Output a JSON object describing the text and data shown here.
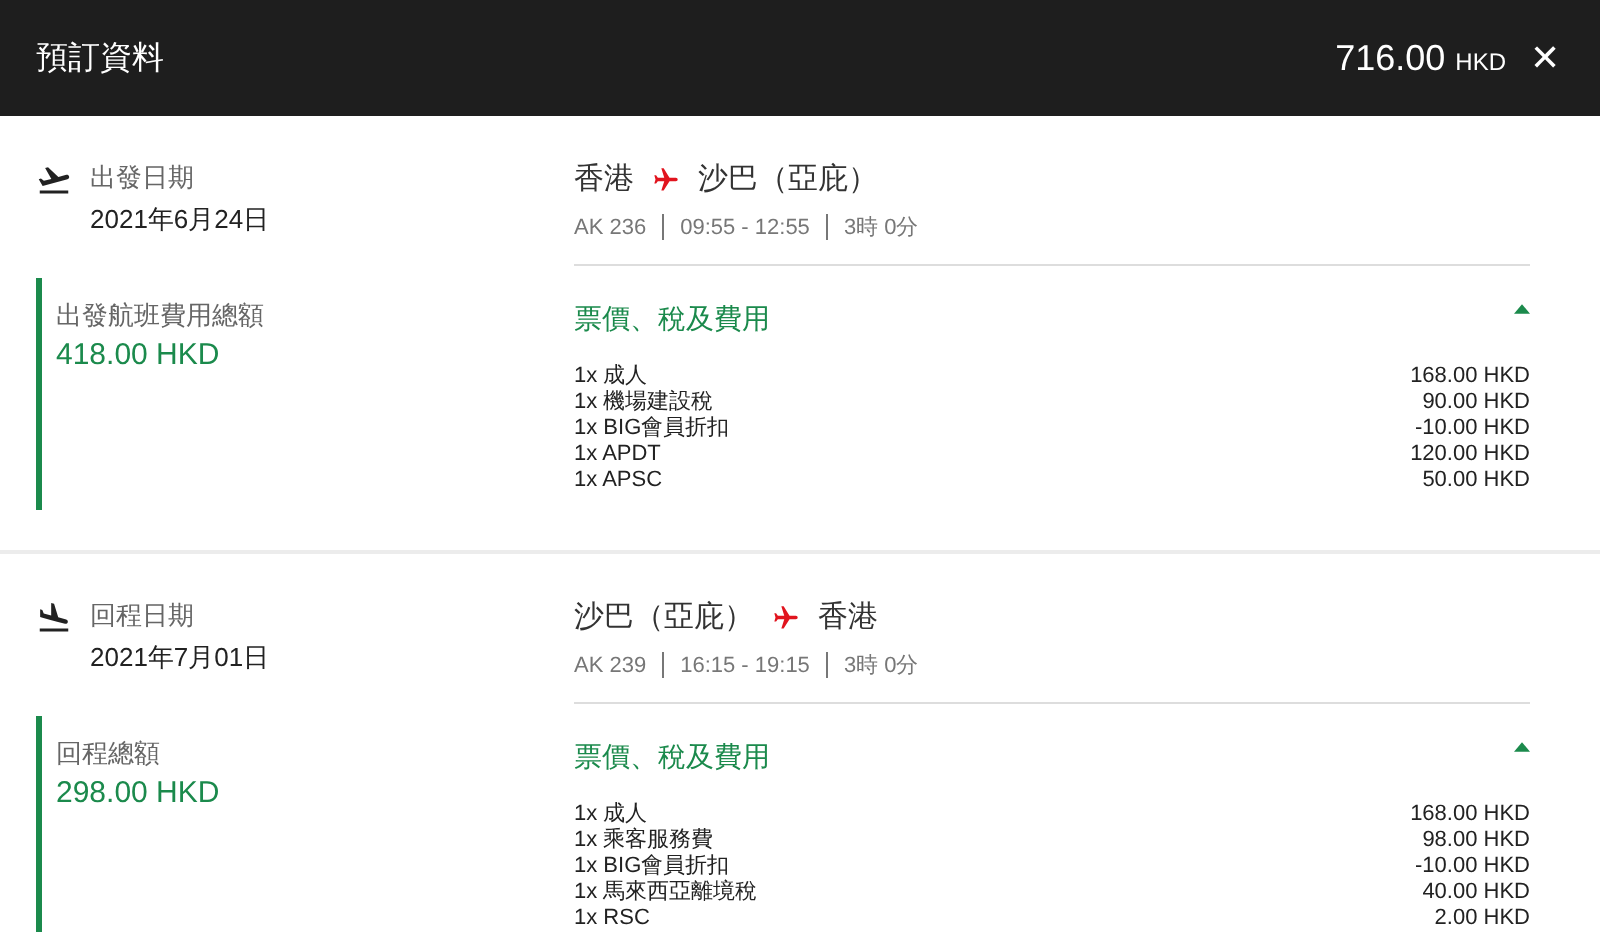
{
  "header": {
    "title": "預訂資料",
    "total_amount": "716.00",
    "total_currency": "HKD",
    "close": "✕"
  },
  "segments": [
    {
      "kind": "departure",
      "date_label": "出發日期",
      "date": "2021年6月24日",
      "summary_label": "出發航班費用總額",
      "summary_amount": "418.00 HKD",
      "origin": "香港",
      "destination": "沙巴（亞庇）",
      "flight": "AK 236",
      "time": "09:55 - 12:55",
      "duration": "3時 0分",
      "fees_title": "票價、稅及費用",
      "expanded": true,
      "fees": [
        {
          "label": "1x 成人",
          "amount": "168.00 HKD"
        },
        {
          "label": "1x 機場建設稅",
          "amount": "90.00 HKD"
        },
        {
          "label": "1x BIG會員折扣",
          "amount": "-10.00 HKD"
        },
        {
          "label": "1x APDT",
          "amount": "120.00 HKD"
        },
        {
          "label": "1x APSC",
          "amount": "50.00 HKD"
        }
      ]
    },
    {
      "kind": "return",
      "date_label": "回程日期",
      "date": "2021年7月01日",
      "summary_label": "回程總額",
      "summary_amount": "298.00 HKD",
      "origin": "沙巴（亞庇）",
      "destination": "香港",
      "flight": "AK 239",
      "time": "16:15 - 19:15",
      "duration": "3時 0分",
      "fees_title": "票價、稅及費用",
      "expanded": true,
      "fees": [
        {
          "label": "1x 成人",
          "amount": "168.00 HKD"
        },
        {
          "label": "1x 乘客服務費",
          "amount": "98.00 HKD"
        },
        {
          "label": "1x BIG會員折扣",
          "amount": "-10.00 HKD"
        },
        {
          "label": "1x 馬來西亞離境稅",
          "amount": "40.00 HKD"
        },
        {
          "label": "1x RSC",
          "amount": "2.00 HKD"
        }
      ]
    }
  ]
}
